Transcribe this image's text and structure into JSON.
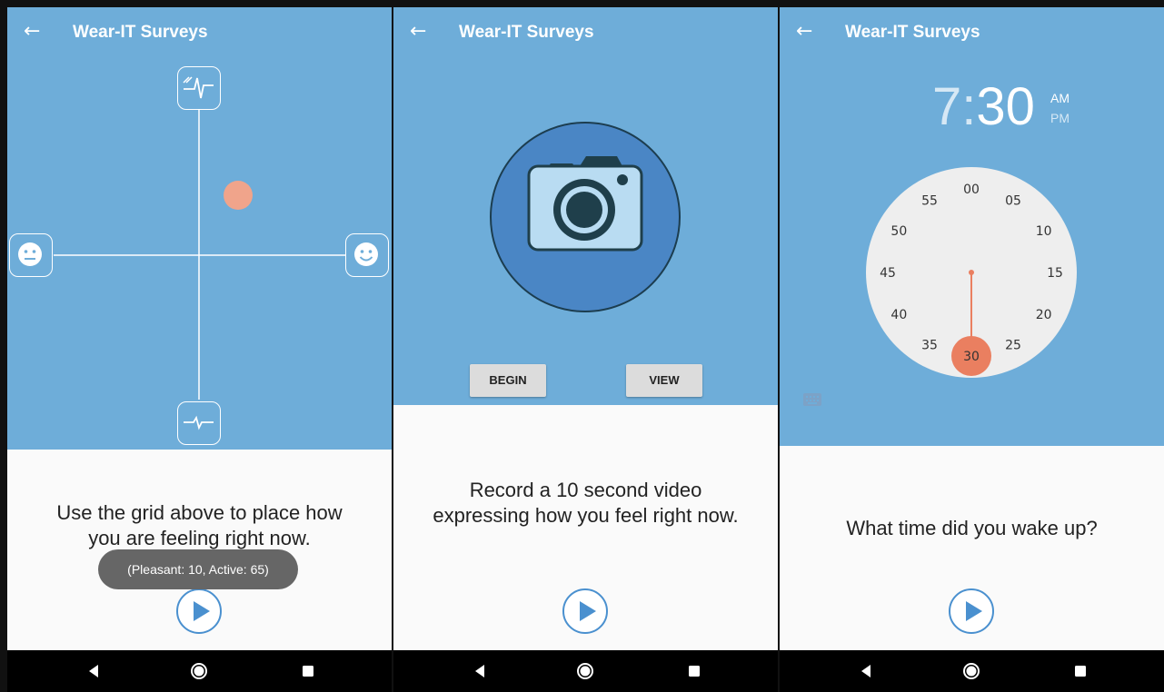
{
  "app": {
    "title": "Wear-IT Surveys"
  },
  "panel1": {
    "prompt_line1": "Use the grid above to place how",
    "prompt_line2": "you are feeling right now.",
    "toast": "(Pleasant: 10, Active: 65)",
    "marker": {
      "pleasant": 10,
      "active": 65
    }
  },
  "panel2": {
    "begin_label": "BEGIN",
    "view_label": "VIEW",
    "prompt_line1": "Record a 10 second video",
    "prompt_line2": "expressing how you feel right now."
  },
  "panel3": {
    "hour": "7",
    "colon": ":",
    "minute": "30",
    "am": "AM",
    "pm": "PM",
    "selected_minute": "30",
    "minutes": [
      "00",
      "05",
      "10",
      "15",
      "20",
      "25",
      "30",
      "35",
      "40",
      "45",
      "50",
      "55"
    ],
    "prompt": "What time did you wake up?"
  },
  "colors": {
    "sky": "#6eadd9",
    "marker": "#f0a48b",
    "clock_accent": "#ea7f60",
    "camera_outer": "#4a86c5",
    "camera_body": "#b9dcf2",
    "camera_dark": "#1f3f4b"
  },
  "icons": {
    "top": "heart-rate-high-icon",
    "bottom": "heart-rate-low-icon",
    "left": "neutral-face-icon",
    "right": "smiley-face-icon",
    "camera": "camera-icon",
    "keyboard": "keyboard-icon",
    "play": "play-icon",
    "back": "arrow-left-icon"
  }
}
